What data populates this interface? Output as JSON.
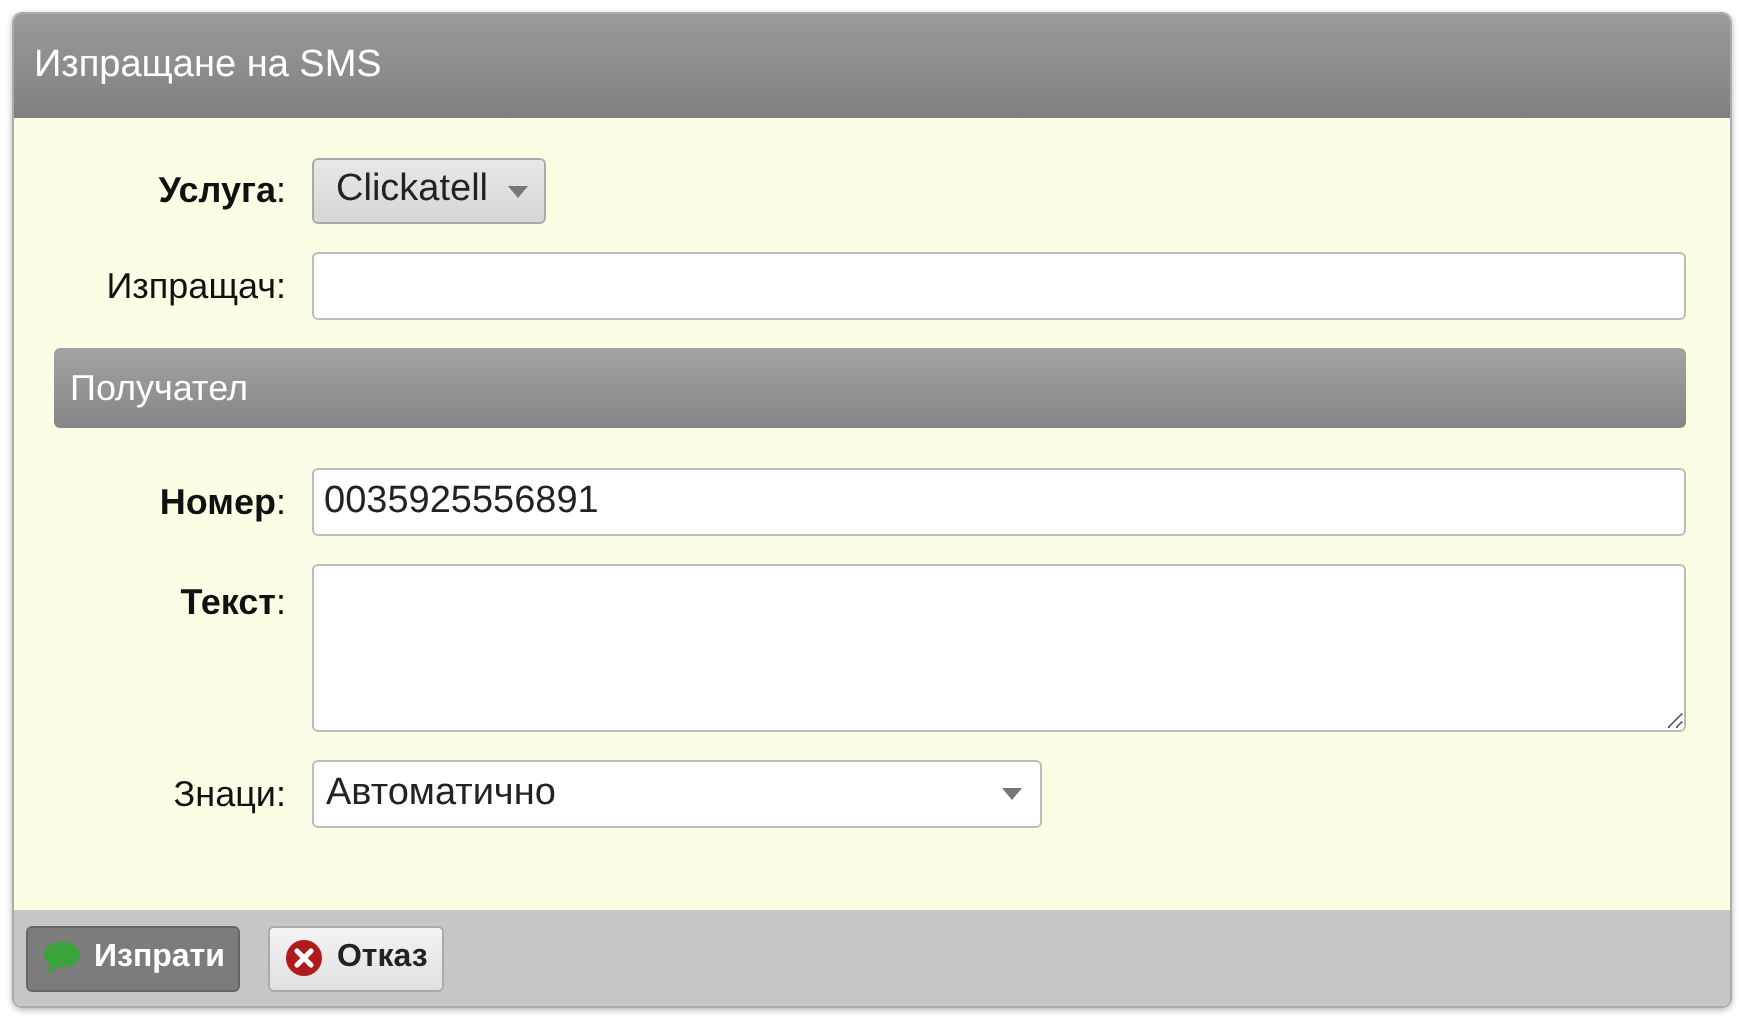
{
  "window": {
    "title": "Изпращане на SMS"
  },
  "fields": [
    {
      "label": "**Услуга**:",
      "kind": "dropdown-button",
      "value": "Clickatell"
    },
    {
      "label": "Изпращач:",
      "kind": "input"
    }
  ],
  "section": {
    "title": "Получател"
  },
  "recipient_fields": [
    {
      "label": "**Номер**:",
      "kind": "input",
      "value": "0035925556891"
    },
    {
      "label": "**Текст**:",
      "kind": "textarea"
    },
    {
      "label": "Знаци:",
      "kind": "select",
      "value": "Автоматично"
    }
  ],
  "buttons": [
    {
      "label": "Изпрати",
      "kind": "primary"
    },
    {
      "label": "Отказ",
      "kind": "cancel"
    }
  ]
}
